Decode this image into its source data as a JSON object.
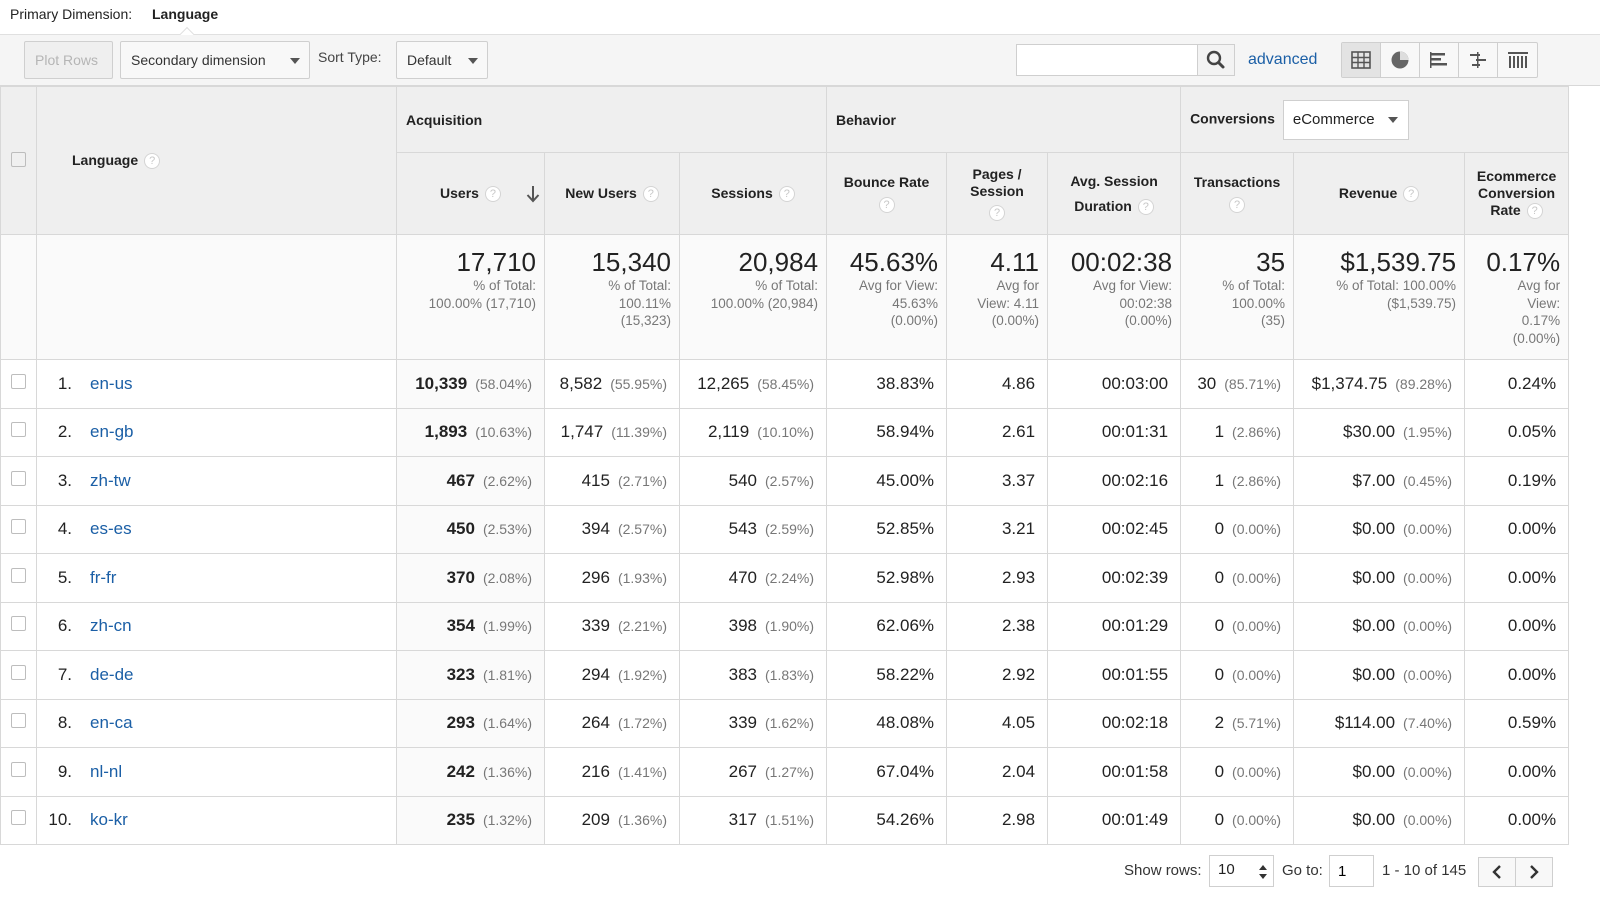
{
  "primary": {
    "label": "Primary Dimension:",
    "value": "Language"
  },
  "toolbar": {
    "plot_rows": "Plot Rows",
    "secondary_dimension": "Secondary dimension",
    "sort_type_label": "Sort Type:",
    "sort_type_value": "Default",
    "search_value": "",
    "advanced": "advanced"
  },
  "header": {
    "dimension": "Language",
    "group_acquisition": "Acquisition",
    "group_behavior": "Behavior",
    "group_conversions": "Conversions",
    "conversion_select": "eCommerce",
    "cols": {
      "users": "Users",
      "new_users": "New Users",
      "sessions": "Sessions",
      "bounce_rate": "Bounce Rate",
      "pages_session": "Pages / Session",
      "avg_duration": "Avg. Session Duration",
      "transactions": "Transactions",
      "revenue": "Revenue",
      "conversion_rate": "Ecommerce Conversion Rate"
    }
  },
  "totals": {
    "users": {
      "big": "17,710",
      "l1": "% of Total:",
      "l2": "100.00% (17,710)"
    },
    "new_users": {
      "big": "15,340",
      "l1": "% of Total:",
      "l2": "100.11%",
      "l3": "(15,323)"
    },
    "sessions": {
      "big": "20,984",
      "l1": "% of Total:",
      "l2": "100.00% (20,984)"
    },
    "bounce_rate": {
      "big": "45.63%",
      "l1": "Avg for View:",
      "l2": "45.63%",
      "l3": "(0.00%)"
    },
    "pages_session": {
      "big": "4.11",
      "l1": "Avg for",
      "l2": "View: 4.11",
      "l3": "(0.00%)"
    },
    "avg_duration": {
      "big": "00:02:38",
      "l1": "Avg for View:",
      "l2": "00:02:38",
      "l3": "(0.00%)"
    },
    "transactions": {
      "big": "35",
      "l1": "% of Total:",
      "l2": "100.00%",
      "l3": "(35)"
    },
    "revenue": {
      "big": "$1,539.75",
      "l1": "% of Total: 100.00%",
      "l2": "($1,539.75)"
    },
    "conversion_rate": {
      "big": "0.17%",
      "l1": "Avg for",
      "l2": "View:",
      "l3": "0.17%",
      "l4": "(0.00%)"
    }
  },
  "rows": [
    {
      "rank": "1.",
      "lang": "en-us",
      "users": "10,339",
      "users_pct": "(58.04%)",
      "new_users": "8,582",
      "new_users_pct": "(55.95%)",
      "sessions": "12,265",
      "sessions_pct": "(58.45%)",
      "bounce": "38.83%",
      "pages": "4.86",
      "duration": "00:03:00",
      "trans": "30",
      "trans_pct": "(85.71%)",
      "revenue": "$1,374.75",
      "revenue_pct": "(89.28%)",
      "conv": "0.24%"
    },
    {
      "rank": "2.",
      "lang": "en-gb",
      "users": "1,893",
      "users_pct": "(10.63%)",
      "new_users": "1,747",
      "new_users_pct": "(11.39%)",
      "sessions": "2,119",
      "sessions_pct": "(10.10%)",
      "bounce": "58.94%",
      "pages": "2.61",
      "duration": "00:01:31",
      "trans": "1",
      "trans_pct": "(2.86%)",
      "revenue": "$30.00",
      "revenue_pct": "(1.95%)",
      "conv": "0.05%"
    },
    {
      "rank": "3.",
      "lang": "zh-tw",
      "users": "467",
      "users_pct": "(2.62%)",
      "new_users": "415",
      "new_users_pct": "(2.71%)",
      "sessions": "540",
      "sessions_pct": "(2.57%)",
      "bounce": "45.00%",
      "pages": "3.37",
      "duration": "00:02:16",
      "trans": "1",
      "trans_pct": "(2.86%)",
      "revenue": "$7.00",
      "revenue_pct": "(0.45%)",
      "conv": "0.19%"
    },
    {
      "rank": "4.",
      "lang": "es-es",
      "users": "450",
      "users_pct": "(2.53%)",
      "new_users": "394",
      "new_users_pct": "(2.57%)",
      "sessions": "543",
      "sessions_pct": "(2.59%)",
      "bounce": "52.85%",
      "pages": "3.21",
      "duration": "00:02:45",
      "trans": "0",
      "trans_pct": "(0.00%)",
      "revenue": "$0.00",
      "revenue_pct": "(0.00%)",
      "conv": "0.00%"
    },
    {
      "rank": "5.",
      "lang": "fr-fr",
      "users": "370",
      "users_pct": "(2.08%)",
      "new_users": "296",
      "new_users_pct": "(1.93%)",
      "sessions": "470",
      "sessions_pct": "(2.24%)",
      "bounce": "52.98%",
      "pages": "2.93",
      "duration": "00:02:39",
      "trans": "0",
      "trans_pct": "(0.00%)",
      "revenue": "$0.00",
      "revenue_pct": "(0.00%)",
      "conv": "0.00%"
    },
    {
      "rank": "6.",
      "lang": "zh-cn",
      "users": "354",
      "users_pct": "(1.99%)",
      "new_users": "339",
      "new_users_pct": "(2.21%)",
      "sessions": "398",
      "sessions_pct": "(1.90%)",
      "bounce": "62.06%",
      "pages": "2.38",
      "duration": "00:01:29",
      "trans": "0",
      "trans_pct": "(0.00%)",
      "revenue": "$0.00",
      "revenue_pct": "(0.00%)",
      "conv": "0.00%"
    },
    {
      "rank": "7.",
      "lang": "de-de",
      "users": "323",
      "users_pct": "(1.81%)",
      "new_users": "294",
      "new_users_pct": "(1.92%)",
      "sessions": "383",
      "sessions_pct": "(1.83%)",
      "bounce": "58.22%",
      "pages": "2.92",
      "duration": "00:01:55",
      "trans": "0",
      "trans_pct": "(0.00%)",
      "revenue": "$0.00",
      "revenue_pct": "(0.00%)",
      "conv": "0.00%"
    },
    {
      "rank": "8.",
      "lang": "en-ca",
      "users": "293",
      "users_pct": "(1.64%)",
      "new_users": "264",
      "new_users_pct": "(1.72%)",
      "sessions": "339",
      "sessions_pct": "(1.62%)",
      "bounce": "48.08%",
      "pages": "4.05",
      "duration": "00:02:18",
      "trans": "2",
      "trans_pct": "(5.71%)",
      "revenue": "$114.00",
      "revenue_pct": "(7.40%)",
      "conv": "0.59%"
    },
    {
      "rank": "9.",
      "lang": "nl-nl",
      "users": "242",
      "users_pct": "(1.36%)",
      "new_users": "216",
      "new_users_pct": "(1.41%)",
      "sessions": "267",
      "sessions_pct": "(1.27%)",
      "bounce": "67.04%",
      "pages": "2.04",
      "duration": "00:01:58",
      "trans": "0",
      "trans_pct": "(0.00%)",
      "revenue": "$0.00",
      "revenue_pct": "(0.00%)",
      "conv": "0.00%"
    },
    {
      "rank": "10.",
      "lang": "ko-kr",
      "users": "235",
      "users_pct": "(1.32%)",
      "new_users": "209",
      "new_users_pct": "(1.36%)",
      "sessions": "317",
      "sessions_pct": "(1.51%)",
      "bounce": "54.26%",
      "pages": "2.98",
      "duration": "00:01:49",
      "trans": "0",
      "trans_pct": "(0.00%)",
      "revenue": "$0.00",
      "revenue_pct": "(0.00%)",
      "conv": "0.00%"
    }
  ],
  "footer": {
    "show_rows_label": "Show rows:",
    "show_rows_value": "10",
    "goto_label": "Go to:",
    "goto_value": "1",
    "range": "1 - 10 of 145"
  },
  "colors": {
    "link": "#1b5fa6",
    "header_bg": "#efefef",
    "border": "#d8d8d8"
  }
}
